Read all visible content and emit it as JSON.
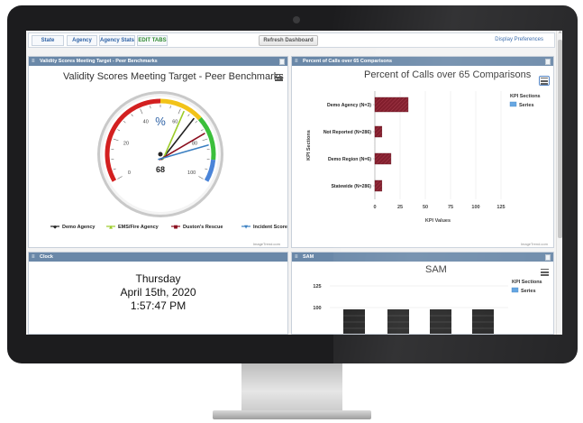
{
  "tabs": [
    {
      "label": "State"
    },
    {
      "label": "Agency"
    },
    {
      "label": "Agency Stats"
    },
    {
      "label": "EDIT TABS"
    }
  ],
  "toolbar": {
    "refresh_label": "Refresh Dashboard",
    "prefs_label": "Display Preferences"
  },
  "colors": {
    "header": "#6a88a8",
    "accent": "#2e62a6",
    "bar_fill": "#7a1020",
    "gauge_red": "#d32020",
    "gauge_yellow": "#f2c319",
    "gauge_green": "#3bbf3b",
    "gauge_blue": "#4a84d8"
  },
  "panels": {
    "validity": {
      "header": "Validity Scores Meeting Target - Peer Benchmarks",
      "title": "Validity Scores Meeting Target - Peer Benchmarks",
      "credit": "ImageTrend.com"
    },
    "percent": {
      "header": "Percent of Calls over 65 Comparisons",
      "title": "Percent of Calls over 65 Comparisons",
      "credit": "ImageTrend.com"
    },
    "clock": {
      "header": "Clock",
      "day": "Thursday",
      "date": "April 15th, 2020",
      "time": "1:57:47 PM"
    },
    "sam": {
      "header": "SAM",
      "title": "SAM"
    }
  },
  "chart_data": [
    {
      "type": "gauge",
      "title": "Validity Scores Meeting Target - Peer Benchmarks",
      "unit": "%",
      "value_label": "68",
      "range": [
        0,
        100
      ],
      "ticks": [
        "0",
        "20",
        "40",
        "60",
        "80",
        "100"
      ],
      "bands": [
        {
          "from": 0,
          "to": 50,
          "color": "#d32020"
        },
        {
          "from": 50,
          "to": 70,
          "color": "#f2c319"
        },
        {
          "from": 70,
          "to": 90,
          "color": "#3bbf3b"
        },
        {
          "from": 90,
          "to": 100,
          "color": "#4a84d8"
        }
      ],
      "series": [
        {
          "name": "Demo Agency",
          "value": 68,
          "color": "#222222",
          "marker": "◆"
        },
        {
          "name": "EMS/Fire Agency",
          "value": 62,
          "color": "#9ccc2a",
          "marker": "▲"
        },
        {
          "name": "Duston's Rescue",
          "value": 77,
          "color": "#8b0f1f",
          "marker": "■"
        },
        {
          "name": "Incident Scores",
          "value": 83,
          "color": "#3a7fc1",
          "marker": "▼"
        }
      ]
    },
    {
      "type": "bar",
      "orientation": "horizontal",
      "title": "Percent of Calls over 65 Comparisons",
      "xlabel": "KPI Values",
      "ylabel": "KPI Sections",
      "categories": [
        "Demo Agency (N=3)",
        "Not Reported (N=286)",
        "Demo Region (N=6)",
        "Statewide (N=286)"
      ],
      "values": [
        33,
        7,
        16,
        7
      ],
      "xlim": [
        0,
        125
      ],
      "xticks": [
        "0",
        "25",
        "50",
        "75",
        "100",
        "125"
      ],
      "legend": {
        "title": "KPI Sections",
        "items": [
          "Series"
        ],
        "position": "right"
      }
    },
    {
      "type": "bar",
      "title": "SAM",
      "yticks": [
        "125",
        "100"
      ],
      "legend": {
        "title": "KPI Sections",
        "items": [
          "Series"
        ],
        "position": "right"
      }
    }
  ]
}
